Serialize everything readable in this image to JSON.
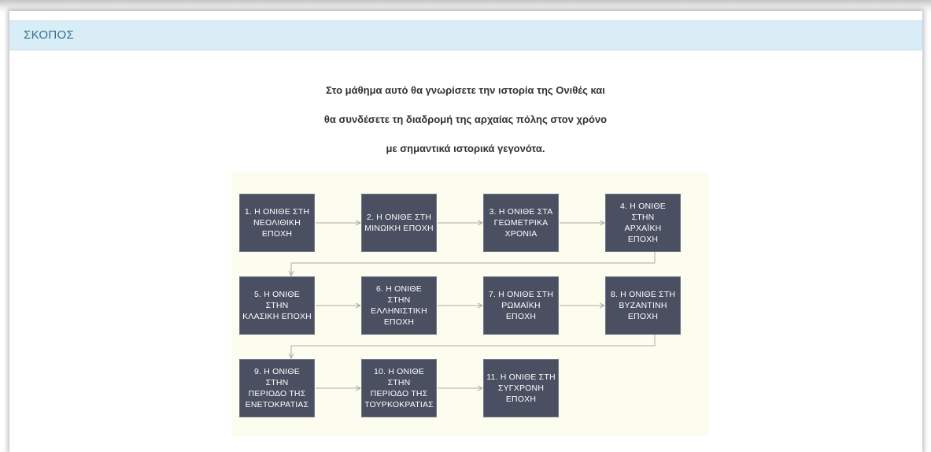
{
  "panel": {
    "title": "ΣΚΟΠΟΣ"
  },
  "intro": {
    "lines": [
      "Στο μάθημα αυτό θα γνωρίσετε την ιστορία της Ονιθές και",
      "θα συνδέσετε τη διαδρομή της αρχαίας πόλης στον χρόνο",
      "με σημαντικά ιστορικά γεγονότα."
    ]
  },
  "diagram": {
    "steps": [
      {
        "label": "1. Η ΟΝΙΘΕ ΣΤΗ\nΝΕΟΛΙΘΙΚΗ ΕΠΟΧΗ"
      },
      {
        "label": "2. Η ΟΝΙΘΕ ΣΤΗ\nΜΙΝΩΙΚΗ ΕΠΟΧΗ"
      },
      {
        "label": "3. Η ΟΝΙΘΕ ΣΤΑ\nΓΕΩΜΕΤΡΙΚΑ\nΧΡΟΝΙΑ"
      },
      {
        "label": "4. Η ΟΝΙΘΕ ΣΤΗΝ\nΑΡΧΑΪΚΗ ΕΠΟΧΗ"
      },
      {
        "label": "5. Η ΟΝΙΘΕ ΣΤΗΝ\nΚΛΑΣΙΚΗ ΕΠΟΧΗ"
      },
      {
        "label": "6. Η ΟΝΙΘΕ ΣΤΗΝ\nΕΛΛΗΝΙΣΤΙΚΗ\nΕΠΟΧΗ"
      },
      {
        "label": "7. Η ΟΝΙΘΕ ΣΤΗ\nΡΩΜΑΪΚΗ ΕΠΟΧΗ"
      },
      {
        "label": "8. Η ΟΝΙΘΕ ΣΤΗ\nΒΥΖΑΝΤΙΝΗ ΕΠΟΧΗ"
      },
      {
        "label": "9. Η ΟΝΙΘΕ ΣΤΗΝ\nΠΕΡΙΟΔΟ ΤΗΣ\nΕΝΕΤΟΚΡΑΤΙΑΣ"
      },
      {
        "label": "10. Η ΟΝΙΘΕ ΣΤΗΝ\nΠΕΡΙΟΔΟ ΤΗΣ\nΤΟΥΡΚΟΚΡΑΤΙΑΣ"
      },
      {
        "label": "11. Η ΟΝΙΘΕ ΣΤΗ\nΣΥΓΧΡΟΝΗ ΕΠΟΧΗ"
      }
    ],
    "colors": {
      "box_fill": "#4a4f61",
      "box_text": "#ffffff",
      "connector": "#a9a9a9",
      "background": "#fdfdef"
    }
  }
}
